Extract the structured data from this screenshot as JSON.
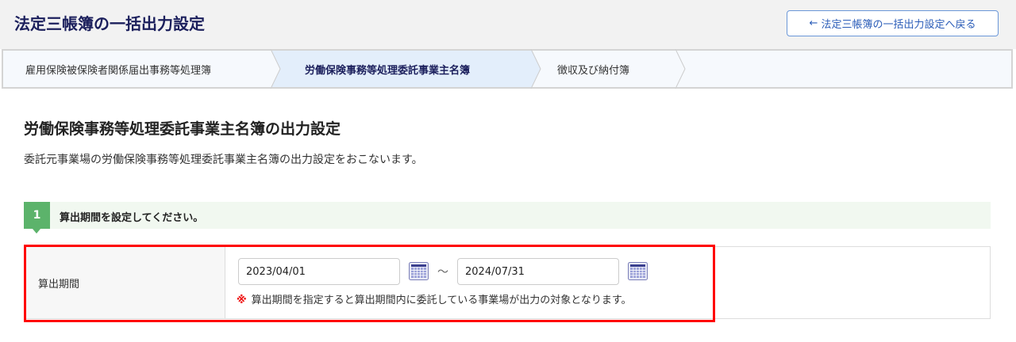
{
  "header": {
    "title": "法定三帳簿の一括出力設定",
    "back_button": "法定三帳簿の一括出力設定へ戻る",
    "back_icon": "arrow-left-icon"
  },
  "steps": [
    {
      "label": "雇用保険被保険者関係届出事務等処理簿",
      "active": false
    },
    {
      "label": "労働保険事務等処理委託事業主名簿",
      "active": true
    },
    {
      "label": "徴収及び納付簿",
      "active": false
    }
  ],
  "main": {
    "heading": "労働保険事務等処理委託事業主名簿の出力設定",
    "description": "委託元事業場の労働保険事務等処理委託事業主名簿の出力設定をおこないます。"
  },
  "section": {
    "number": "1",
    "label": "算出期間を設定してください。"
  },
  "form": {
    "field_label": "算出期間",
    "start_date": "2023/04/01",
    "separator": "～",
    "end_date": "2024/07/31",
    "note_mark": "※",
    "note": "算出期間を指定すると算出期間内に委託している事業場が出力の対象となります。"
  }
}
